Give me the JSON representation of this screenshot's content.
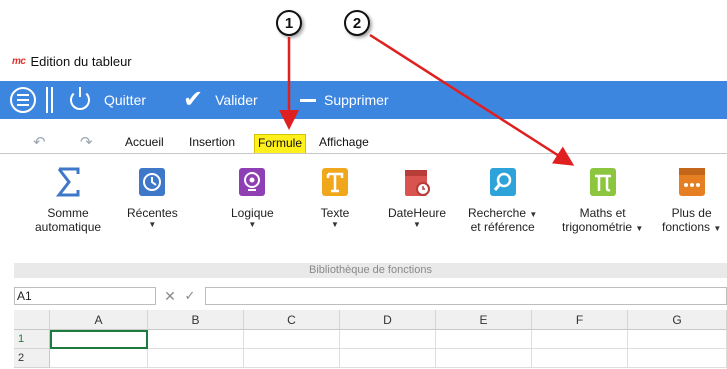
{
  "callouts": [
    "1",
    "2"
  ],
  "window": {
    "title": "Edition du tableur",
    "logo": "mc"
  },
  "commandbar": {
    "quit": "Quitter",
    "validate": "Valider",
    "delete": "Supprimer"
  },
  "tabs": [
    {
      "label": "Accueil"
    },
    {
      "label": "Insertion"
    },
    {
      "label": "Formule",
      "active": true
    },
    {
      "label": "Affichage"
    }
  ],
  "ribbon": {
    "buttons": [
      {
        "line1": "Somme",
        "line2": "automatique",
        "icon": "sigma-icon"
      },
      {
        "line1": "Récentes",
        "line2": "",
        "icon": "history-icon",
        "dropdown": true
      },
      {
        "line1": "Logique",
        "line2": "",
        "icon": "logic-icon",
        "dropdown": true
      },
      {
        "line1": "Texte",
        "line2": "",
        "icon": "text-icon",
        "dropdown": true
      },
      {
        "line1": "DateHeure",
        "line2": "",
        "icon": "datetime-icon",
        "dropdown": true
      },
      {
        "line1": "Recherche",
        "line2": "et référence",
        "icon": "search-icon",
        "dropdown": true
      },
      {
        "line1": "Maths et",
        "line2": "trigonométrie",
        "icon": "pi-icon",
        "dropdown": true
      },
      {
        "line1": "Plus de",
        "line2": "fonctions",
        "icon": "more-functions-icon",
        "dropdown": true
      }
    ],
    "group_label": "Bibliothèque de fonctions"
  },
  "formula_bar": {
    "name_box": "A1"
  },
  "grid": {
    "columns": [
      "A",
      "B",
      "C",
      "D",
      "E",
      "F",
      "G"
    ],
    "rows": [
      "1",
      "2"
    ]
  },
  "colors": {
    "commandbar": "#3d86e0",
    "active_tab": "#ffef1a",
    "arrow": "#e02020",
    "selection": "#1e7b3f"
  }
}
